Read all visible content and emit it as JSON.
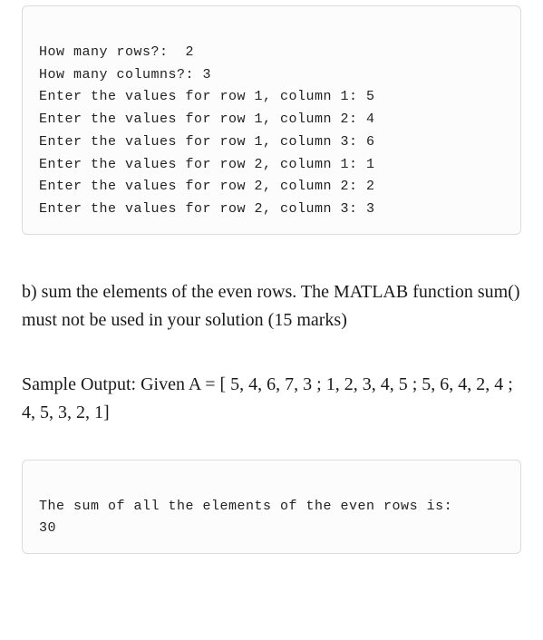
{
  "code_top": {
    "lines": [
      "How many rows?:  2",
      "How many columns?: 3",
      "Enter the values for row 1, column 1: 5",
      "Enter the values for row 1, column 2: 4",
      "Enter the values for row 1, column 3: 6",
      "Enter the values for row 2, column 1: 1",
      "Enter the values for row 2, column 2: 2",
      "Enter the values for row 2, column 3: 3"
    ]
  },
  "question_text": "b) sum the elements of the even rows. The MATLAB function sum() must not be used in your solution (15 marks)",
  "sample_text": "Sample Output:  Given A = [ 5, 4, 6, 7, 3 ; 1, 2, 3, 4, 5 ; 5, 6, 4, 2, 4 ; 4, 5, 3, 2, 1]",
  "code_bottom": {
    "lines": [
      "The sum of all the elements of the even rows is:",
      "30"
    ]
  }
}
